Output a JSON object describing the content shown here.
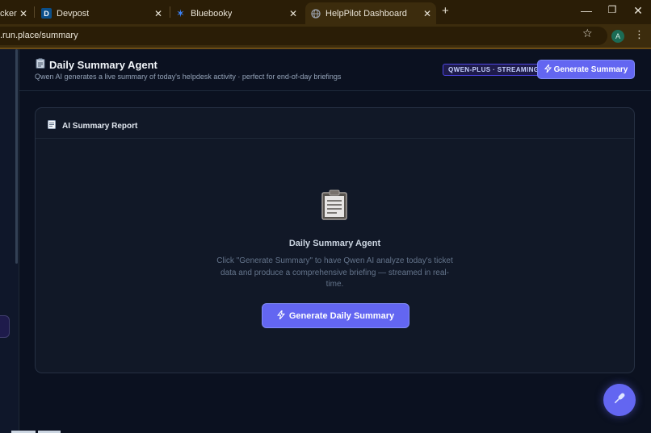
{
  "browser": {
    "tabs": [
      {
        "label": "cker",
        "favicon": "",
        "favicon_color": "",
        "active": false
      },
      {
        "label": "Devpost",
        "favicon": "D",
        "favicon_color": "#0b4f8a",
        "active": false
      },
      {
        "label": "Bluebooky",
        "favicon": "✶",
        "favicon_color": "#3b82f6",
        "active": false
      },
      {
        "label": "HelpPilot Dashboard",
        "favicon": "globe",
        "favicon_color": "#9ca3af",
        "active": true
      }
    ],
    "url": ".run.place/summary",
    "profile_initial": "A"
  },
  "header": {
    "title": "Daily Summary Agent",
    "subtitle": "Qwen AI generates a live summary of today's helpdesk activity · perfect for end-of-day briefings",
    "badge": "QWEN-PLUS · STREAMING",
    "generate_button": "Generate Summary"
  },
  "card": {
    "title": "AI Summary Report",
    "empty_title": "Daily Summary Agent",
    "empty_description": "Click \"Generate Summary\" to have Qwen AI analyze today's ticket data and produce a comprehensive briefing — streamed in real-time.",
    "daily_button": "Generate Daily Summary"
  },
  "colors": {
    "accent": "#6366f1",
    "background": "#0b1120",
    "card": "#111827",
    "chrome": "#2a1d06"
  },
  "icons": {
    "title_icon": "clipboard-icon",
    "card_icon": "memo-icon",
    "button_icon": "lightning-icon",
    "fab_icon": "microphone-icon"
  }
}
